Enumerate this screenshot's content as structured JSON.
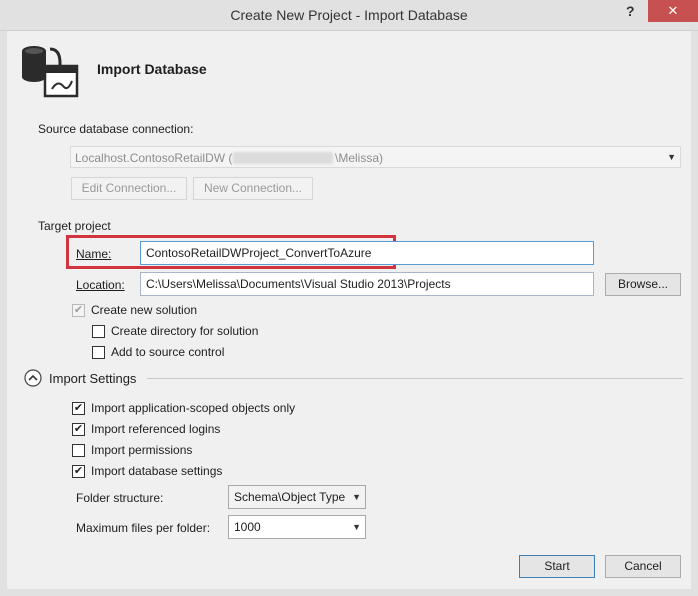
{
  "window": {
    "title": "Create New Project - Import Database",
    "help_glyph": "?",
    "close_glyph": "✕"
  },
  "header": {
    "title": "Import Database",
    "icon": "import-database-icon"
  },
  "source": {
    "section_label": "Source database connection:",
    "connection_prefix": "Localhost.ContosoRetailDW (",
    "connection_suffix": "\\Melissa)",
    "edit_button": "Edit Connection...",
    "new_button": "New Connection..."
  },
  "target": {
    "section_label": "Target project",
    "name_label": "Name:",
    "name_value": "ContosoRetailDWProject_ConvertToAzure",
    "location_label": "Location:",
    "location_value": "C:\\Users\\Melissa\\Documents\\Visual Studio 2013\\Projects",
    "browse_button": "Browse...",
    "create_solution_label": "Create new solution",
    "create_directory_label": "Create directory for solution",
    "source_control_label": "Add to source control"
  },
  "import_settings": {
    "section_label": "Import Settings",
    "options": [
      {
        "label": "Import application-scoped objects only",
        "checked": true
      },
      {
        "label": "Import referenced logins",
        "checked": true
      },
      {
        "label": "Import permissions",
        "checked": false
      },
      {
        "label": "Import database settings",
        "checked": true
      }
    ],
    "folder_structure_label": "Folder structure:",
    "folder_structure_value": "Schema\\Object Type",
    "max_files_label": "Maximum files per folder:",
    "max_files_value": "1000"
  },
  "footer": {
    "start_button": "Start",
    "cancel_button": "Cancel"
  },
  "colors": {
    "highlight": "#d1343f",
    "accent": "#3c7fb1"
  }
}
